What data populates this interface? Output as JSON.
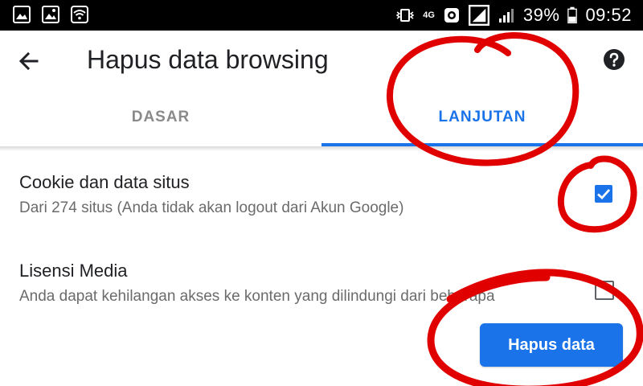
{
  "status_bar": {
    "network": "4G",
    "battery": "39%",
    "time": "09:52"
  },
  "app_bar": {
    "title": "Hapus data browsing",
    "back_icon": "arrow-back-icon",
    "help_icon": "help-icon"
  },
  "tabs": [
    {
      "label": "DASAR",
      "selected": false
    },
    {
      "label": "LANJUTAN",
      "selected": true
    }
  ],
  "options": [
    {
      "title": "Cookie dan data situs",
      "subtitle": "Dari 274 situs (Anda tidak akan logout dari Akun Google)",
      "checked": true
    },
    {
      "title": "Lisensi Media",
      "subtitle": "Anda dapat kehilangan akses ke konten yang dilindungi dari beberapa",
      "checked": false
    }
  ],
  "primary_button": {
    "label": "Hapus data"
  },
  "colors": {
    "accent": "#1a73e8",
    "annotation": "#e00000"
  }
}
